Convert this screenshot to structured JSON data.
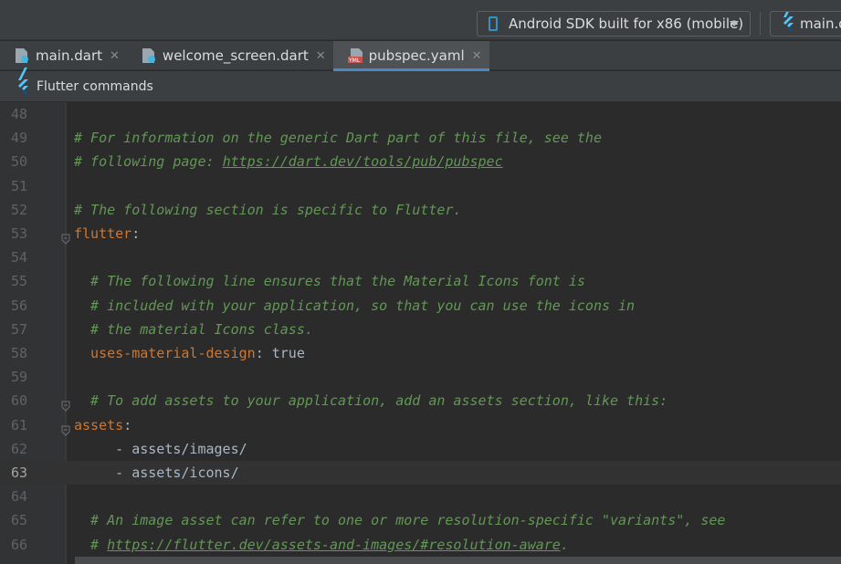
{
  "toolbar": {
    "device": "Android SDK built for x86 (mobile)",
    "run_config": "main.dart"
  },
  "tabs": [
    {
      "label": "main.dart",
      "icon": "dart-file-icon",
      "active": false
    },
    {
      "label": "welcome_screen.dart",
      "icon": "dart-file-icon",
      "active": false
    },
    {
      "label": "pubspec.yaml",
      "icon": "yaml-file-icon",
      "active": true
    }
  ],
  "commands_bar": {
    "label": "Flutter commands"
  },
  "editor": {
    "current_line": 63,
    "lines": [
      {
        "n": "48",
        "parts": []
      },
      {
        "n": "49",
        "parts": [
          {
            "t": "# For information on the generic Dart part of this file, see the",
            "c": "cmt"
          }
        ]
      },
      {
        "n": "50",
        "parts": [
          {
            "t": "# following page: ",
            "c": "cmt"
          },
          {
            "t": "https://dart.dev/tools/pub/pubspec",
            "c": "link"
          }
        ]
      },
      {
        "n": "51",
        "parts": []
      },
      {
        "n": "52",
        "parts": [
          {
            "t": "# The following section is specific to Flutter.",
            "c": "cmt"
          }
        ]
      },
      {
        "n": "53",
        "parts": [
          {
            "t": "flutter",
            "c": "key"
          },
          {
            "t": ":",
            "c": "plain"
          }
        ]
      },
      {
        "n": "54",
        "parts": []
      },
      {
        "n": "55",
        "parts": [
          {
            "t": "  # The following line ensures that the Material Icons font is",
            "c": "cmt"
          }
        ]
      },
      {
        "n": "56",
        "parts": [
          {
            "t": "  # included with your application, so that you can use the icons in",
            "c": "cmt"
          }
        ]
      },
      {
        "n": "57",
        "parts": [
          {
            "t": "  # the material Icons class.",
            "c": "cmt"
          }
        ]
      },
      {
        "n": "58",
        "parts": [
          {
            "t": "  uses-material-design",
            "c": "key"
          },
          {
            "t": ": true",
            "c": "plain"
          }
        ]
      },
      {
        "n": "59",
        "parts": []
      },
      {
        "n": "60",
        "parts": [
          {
            "t": "  # To add assets to your application, add an assets section, like this:",
            "c": "cmt"
          }
        ]
      },
      {
        "n": "61",
        "parts": [
          {
            "t": "assets",
            "c": "key"
          },
          {
            "t": ":",
            "c": "plain"
          }
        ]
      },
      {
        "n": "62",
        "parts": [
          {
            "t": "     - assets/images/",
            "c": "plain"
          }
        ]
      },
      {
        "n": "63",
        "parts": [
          {
            "t": "     - assets/icons/",
            "c": "plain"
          }
        ]
      },
      {
        "n": "64",
        "parts": []
      },
      {
        "n": "65",
        "parts": [
          {
            "t": "  # An image asset can refer to one or more resolution-specific \"variants\", see",
            "c": "cmt"
          }
        ]
      },
      {
        "n": "66",
        "parts": [
          {
            "t": "  # ",
            "c": "cmt"
          },
          {
            "t": "https://flutter.dev/assets-and-images/#resolution-aware",
            "c": "link"
          },
          {
            "t": ".",
            "c": "cmt"
          }
        ]
      }
    ]
  }
}
